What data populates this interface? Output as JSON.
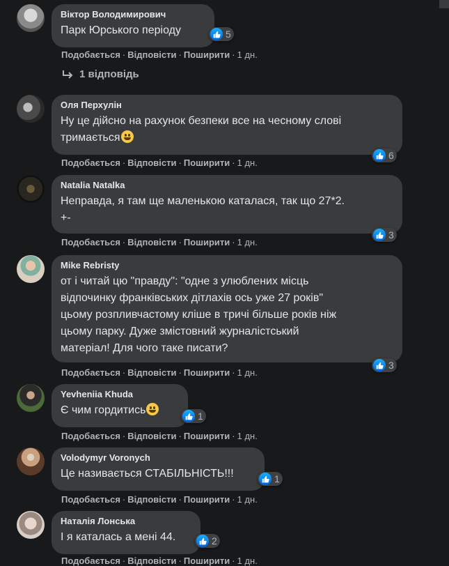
{
  "comments": [
    {
      "author": "Віктор Володимирович",
      "lines": [
        "Парк Юрського періоду"
      ],
      "reactions": "5",
      "actions": {
        "like": "Подобається",
        "reply": "Відповісти",
        "share": "Поширити",
        "time": "1 дн."
      },
      "replies_label": "1 відповідь"
    },
    {
      "author": "Оля Перхулін",
      "lines": [
        "Ну це дійсно на рахунок безпеки все на чесному слові",
        "тримається"
      ],
      "reactions": "6",
      "actions": {
        "like": "Подобається",
        "reply": "Відповісти",
        "share": "Поширити",
        "time": "1 дн."
      }
    },
    {
      "author": "Natalia Natalka",
      "lines": [
        "Неправда, я там ще маленькою каталася, так що 27*2.",
        "+-"
      ],
      "reactions": "3",
      "actions": {
        "like": "Подобається",
        "reply": "Відповісти",
        "share": "Поширити",
        "time": "1 дн."
      }
    },
    {
      "author": "Mike Rebristy",
      "lines": [
        "от і читай цю \"правду\": \"одне з улюблених місць",
        "відпочинку франківських дітлахів ось уже 27 років\"",
        "цьому розпливчастому кліше в тричі більше років ніж",
        "цьому парку. Дуже змістовний журналістський",
        "матеріал! Для чого таке писати?"
      ],
      "reactions": "3",
      "actions": {
        "like": "Подобається",
        "reply": "Відповісти",
        "share": "Поширити",
        "time": "1 дн."
      }
    },
    {
      "author": "Yevheniia Khuda",
      "lines": [
        "Є чим гордитись"
      ],
      "reactions": "1",
      "actions": {
        "like": "Подобається",
        "reply": "Відповісти",
        "share": "Поширити",
        "time": "1 дн."
      }
    },
    {
      "author": "Volodymyr Voronych",
      "lines": [
        "Це називається СТАБІЛЬНІСТЬ!!!"
      ],
      "reactions": "1",
      "actions": {
        "like": "Подобається",
        "reply": "Відповісти",
        "share": "Поширити",
        "time": "1 дн."
      }
    },
    {
      "author": "Наталія Лонська",
      "lines": [
        "І я каталась а мені 44."
      ],
      "reactions": "2",
      "actions": {
        "like": "Подобається",
        "reply": "Відповісти",
        "share": "Поширити",
        "time": "1 дн."
      }
    }
  ],
  "colors": {
    "background": "#18191a",
    "bubble": "#3a3b3c",
    "like_blue": "#1877f2",
    "muted_text": "#b0b3b8"
  }
}
